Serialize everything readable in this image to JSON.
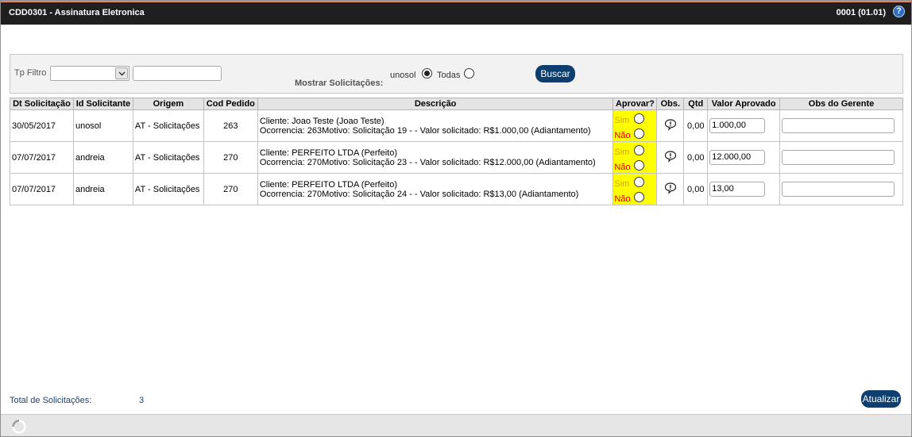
{
  "header": {
    "title": "CDD0301 - Assinatura Eletronica",
    "version": "0001 (01.01)",
    "help_icon": "?"
  },
  "filter": {
    "tp_filtro_label": "Tp Filtro",
    "tp_filtro_value": "",
    "filter_text_value": "",
    "mostrar_label": "Mostrar Solicitações:",
    "option_user": "unosol",
    "option_all": "Todas",
    "selected_option": "unosol",
    "search_button": "Buscar"
  },
  "table": {
    "columns": [
      "Dt Solicitação",
      "Id Solicitante",
      "Origem",
      "Cod Pedido",
      "Descrição",
      "Aprovar?",
      "Obs.",
      "Qtd",
      "Valor Aprovado",
      "Obs do Gerente"
    ],
    "approve_yes": "Sim",
    "approve_no": "Não",
    "rows": [
      {
        "date": "30/05/2017",
        "requester": "unosol",
        "origin": "AT - Solicitações",
        "order_code": "263",
        "desc_line1": "Cliente: Joao Teste (Joao Teste)",
        "desc_line2": "Ocorrencia: 263Motivo: Solicitação 19 - - Valor solicitado: R$1.000,00 (Adiantamento)",
        "qty": "0,00",
        "approved_value": "1.000,00",
        "manager_obs": ""
      },
      {
        "date": "07/07/2017",
        "requester": "andreia",
        "origin": "AT - Solicitações",
        "order_code": "270",
        "desc_line1": "Cliente: PERFEITO LTDA (Perfeito)",
        "desc_line2": "Ocorrencia: 270Motivo: Solicitação 23 - - Valor solicitado: R$12.000,00 (Adiantamento)",
        "qty": "0,00",
        "approved_value": "12.000,00",
        "manager_obs": ""
      },
      {
        "date": "07/07/2017",
        "requester": "andreia",
        "origin": "AT - Solicitações",
        "order_code": "270",
        "desc_line1": "Cliente: PERFEITO LTDA (Perfeito)",
        "desc_line2": "Ocorrencia: 270Motivo: Solicitação 24 - - Valor solicitado: R$13,00 (Adiantamento)",
        "qty": "0,00",
        "approved_value": "13,00",
        "manager_obs": ""
      }
    ]
  },
  "footer": {
    "total_label": "Total de Solicitações:",
    "total_value": "3",
    "update_button": "Atualizar"
  },
  "icons": {
    "help": "help-icon",
    "dropdown": "chevron-down-icon",
    "obs": "speech-bubble-icon",
    "loading": "spinner-icon"
  },
  "colors": {
    "titlebar": "#1f1f1f",
    "button": "#0d3e70",
    "approve_cell": "#ffff00",
    "sim": "#d1a106",
    "nao": "#e00000",
    "total_text": "#1e3f6b"
  }
}
